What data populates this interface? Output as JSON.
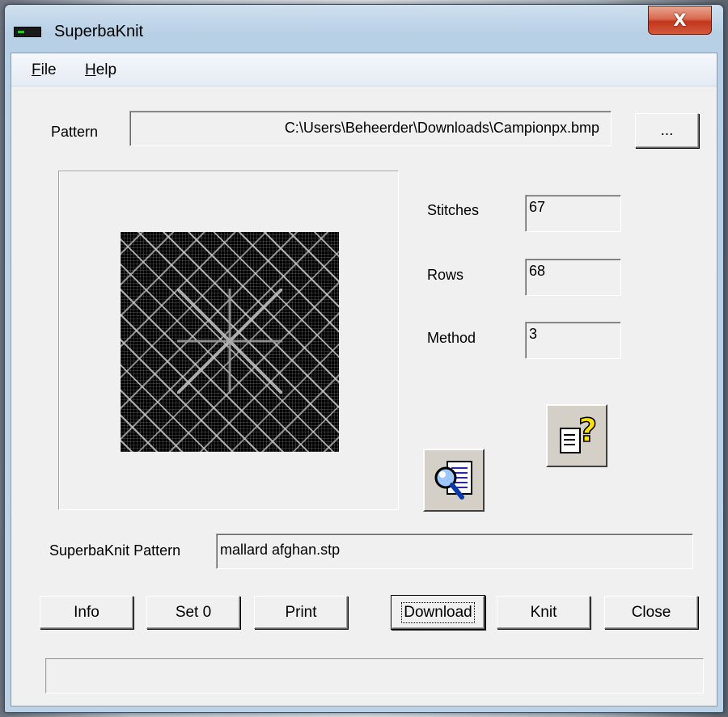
{
  "window": {
    "title": "SuperbaKnit",
    "close_glyph": "X"
  },
  "menu": {
    "file": {
      "accel": "F",
      "rest": "ile"
    },
    "help": {
      "accel": "H",
      "rest": "elp"
    }
  },
  "pattern": {
    "label": "Pattern",
    "path": "C:\\Users\\Beheerder\\Downloads\\Campionpx.bmp",
    "browse_label": "..."
  },
  "stats": {
    "stitches_label": "Stitches",
    "stitches_value": "67",
    "rows_label": "Rows",
    "rows_value": "68",
    "method_label": "Method",
    "method_value": "3"
  },
  "icons": {
    "preview": "magnifier-document-icon",
    "help": "question-document-icon",
    "help_glyph": "?"
  },
  "superbaknit_pattern": {
    "label": "SuperbaKnit Pattern",
    "value": "mallard afghan.stp"
  },
  "buttons": {
    "info": "Info",
    "set0": "Set 0",
    "print": "Print",
    "download": "Download",
    "knit": "Knit",
    "close": "Close"
  },
  "status_text": "",
  "colors": {
    "client_bg": "#f0f0f0",
    "close_button": "#c2361c",
    "title_glass": "#bcd2e7"
  }
}
